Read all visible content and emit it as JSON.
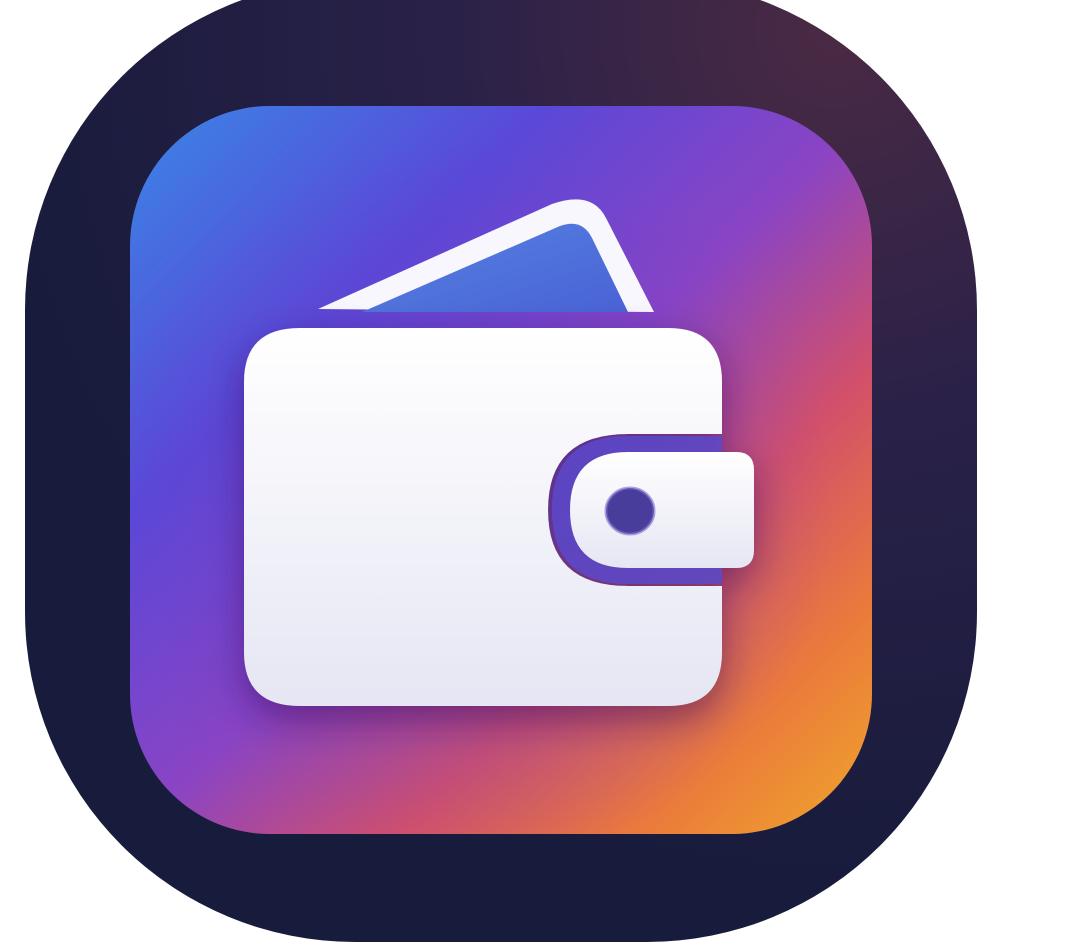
{
  "app_icon": {
    "icon_name": "wallet-icon",
    "colors": {
      "background": "#ffffff",
      "outer_tile_dark": "#1a1c3e",
      "outer_tile_glow": "#4a2a44",
      "gradient_blue": "#3a86e6",
      "gradient_indigo": "#5a48d8",
      "gradient_purple": "#8a44c4",
      "gradient_pink": "#d2506a",
      "gradient_orange": "#ea7a3c",
      "gradient_yellow": "#f0a62a",
      "wallet_white": "#f4f4fb",
      "clasp_dot": "#4a3c9c",
      "card_blue": "#4f7ddc"
    }
  }
}
